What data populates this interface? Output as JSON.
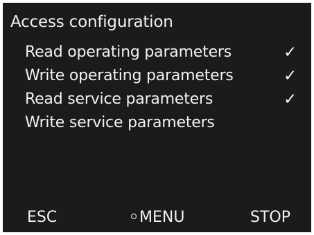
{
  "screen": {
    "title": "Access configuration"
  },
  "permissions": [
    {
      "label": "Read operating parameters",
      "checked": true,
      "check_glyph": "✓"
    },
    {
      "label": "Write operating parameters",
      "checked": true,
      "check_glyph": "✓"
    },
    {
      "label": "Read service parameters",
      "checked": true,
      "check_glyph": "✓"
    },
    {
      "label": "Write service parameters",
      "checked": false,
      "check_glyph": ""
    }
  ],
  "softkeys": {
    "esc": "ESC",
    "menu": "MENU",
    "stop": "STOP",
    "menu_icon": "circle-dot-icon"
  },
  "colors": {
    "background": "#1b1b1b",
    "text": "#f2f2f2"
  }
}
